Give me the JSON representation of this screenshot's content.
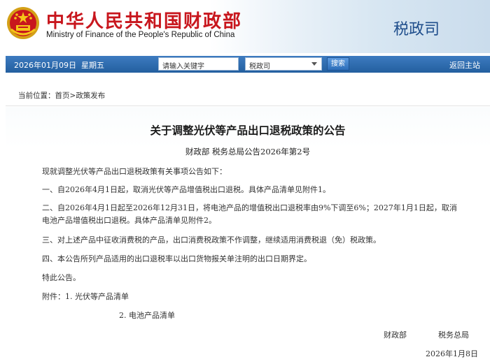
{
  "header": {
    "site_name_cn": "中华人民共和国财政部",
    "site_name_en": "Ministry of Finance of the People's Republic of China",
    "department": "税政司",
    "colors": {
      "brand_red": "#c8161d",
      "brand_blue": "#1f4e8c"
    }
  },
  "nav": {
    "date": "2026年01月09日",
    "weekday": "星期五",
    "search_placeholder": "请输入关键字",
    "select_value": "税政司",
    "search_button": "搜索",
    "home_link": "返回主站"
  },
  "breadcrumb": {
    "prefix": "当前位置：",
    "home": "首页",
    "separator": ">",
    "section": "政策发布"
  },
  "article": {
    "title": "关于调整光伏等产品出口退税政策的公告",
    "doc_number": "财政部  税务总局公告2026年第2号",
    "paragraphs": [
      "现就调整光伏等产品出口退税政策有关事项公告如下：",
      "一、自2026年4月1日起，取消光伏等产品增值税出口退税。具体产品清单见附件1。",
      "二、自2026年4月1日起至2026年12月31日，将电池产品的增值税出口退税率由9%下调至6%；2027年1月1日起，取消电池产品增值税出口退税。具体产品清单见附件2。",
      "三、对上述产品中征收消费税的产品，出口消费税政策不作调整，继续适用消费税退（免）税政策。",
      "四、本公告所列产品适用的出口退税率以出口货物报关单注明的出口日期界定。",
      "特此公告。",
      "附件：1. 光伏等产品清单"
    ],
    "attachment_2": "2. 电池产品清单",
    "signer_1": "财政部",
    "signer_2": "税务总局",
    "date": "2026年1月8日"
  }
}
